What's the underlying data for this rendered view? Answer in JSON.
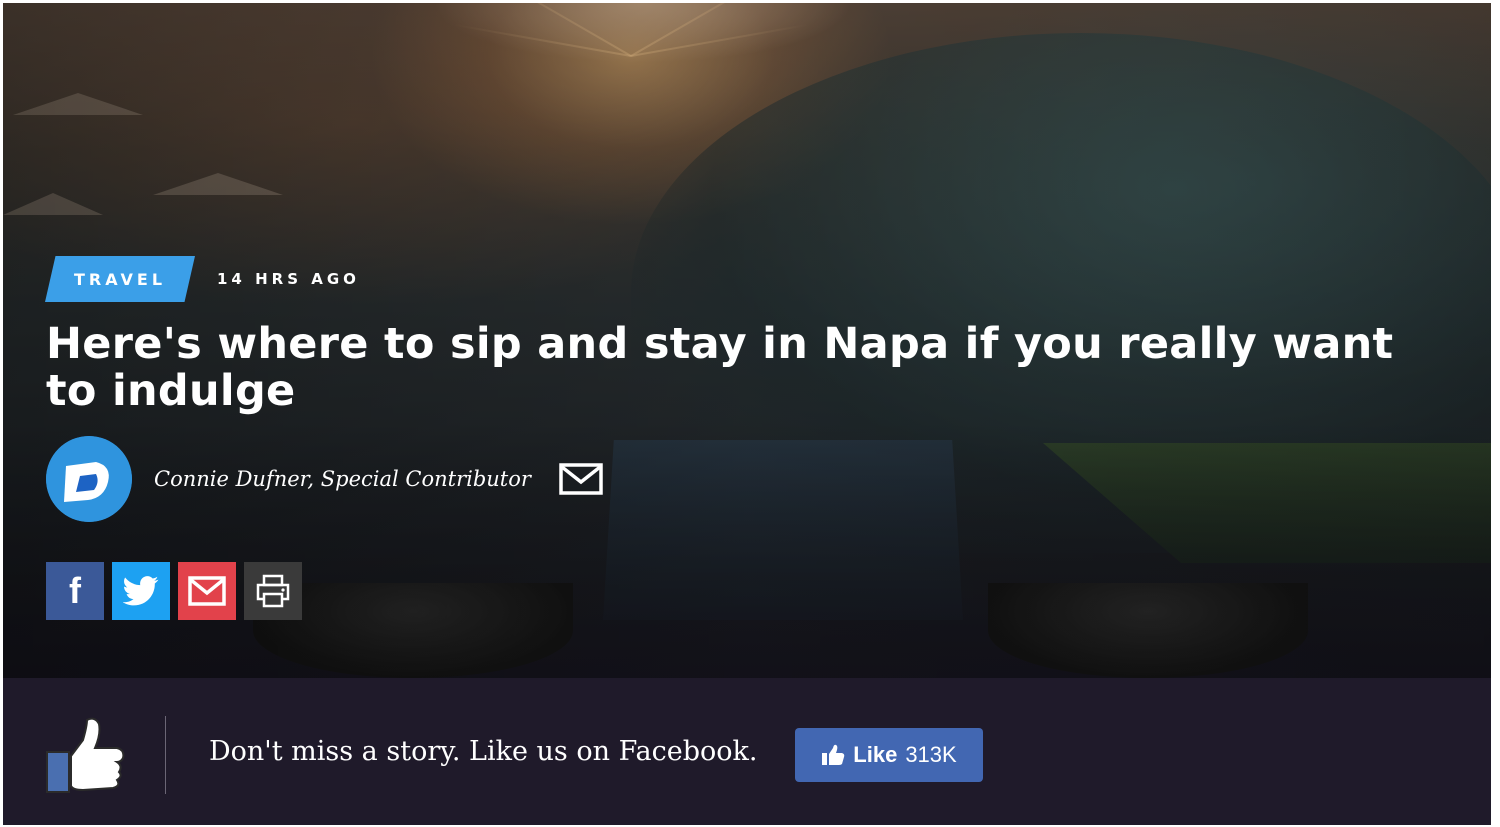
{
  "article": {
    "category": "TRAVEL",
    "timestamp": "14 HRS AGO",
    "headline": "Here's where to sip and stay in Napa if you really want to indulge",
    "author": "Connie Dufner, Special Contributor"
  },
  "share": {
    "facebook_icon": "f",
    "icons": [
      "facebook-icon",
      "twitter-icon",
      "mail-icon",
      "print-icon"
    ],
    "colors": {
      "facebook": "#3b5998",
      "twitter": "#1da1f2",
      "mail": "#e2424b",
      "print": "#3a3a3a"
    }
  },
  "facebook_prompt": {
    "text": "Don't miss a story. Like us on Facebook.",
    "like_label": "Like",
    "like_count": "313K"
  },
  "colors": {
    "accent": "#3b9fe8",
    "bar_background": "#1f1a2a",
    "facebook_button": "#4267b2"
  }
}
